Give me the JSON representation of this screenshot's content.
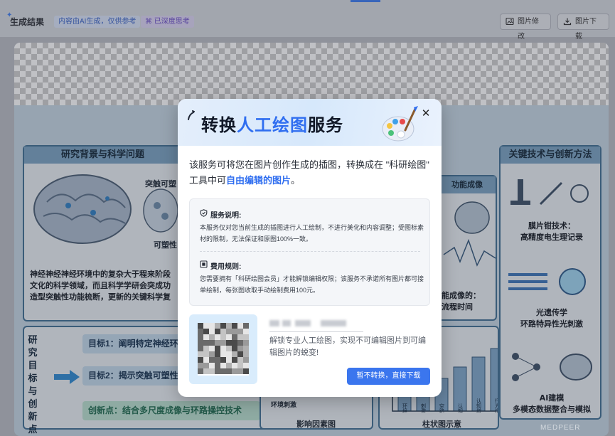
{
  "header": {
    "title": "生成结果",
    "badge_ai": "内容由AI生成，仅供参考",
    "badge_think": "已深度思考",
    "edit_button": "图片修改",
    "download_button": "图片下载"
  },
  "poster": {
    "left_panel_title": "研究背景与科学问题",
    "synapse_label": "突触可塑",
    "plasticity_label": "可塑性",
    "background_text": "神经神经神经环境中的复杂大于程来阶段文化的科学领域，而且科学学研会突成功造型突触性功能梳断，更新的关键科学复",
    "right_panel_title": "关键技术与创新方法",
    "tech1": "膜片钳技术：\n高精度电生理记录",
    "tech2": "光遗传学\n环路特异性光刺激",
    "tech3": "AI建模\n多模态数据整合与模拟",
    "mid_panel_title": "功能成像",
    "mid_caption": "能成像的：\n流程时间",
    "goals_vertical": "研究目标与创新点",
    "goal1": "目标1：阐明特定神经环路",
    "goal2": "目标2：揭示突触可塑性",
    "innovation": "创新点：结合多尺度成像与环路操控技术",
    "bottom_label_stim": "环境刺激",
    "bottom_caption_left": "影响因素图",
    "bottom_caption_right": "柱状图示意",
    "bar_labels": [
      "环境",
      "刺激",
      "空路",
      "认知",
      "认知增强",
      "行为增强"
    ]
  },
  "modal": {
    "title_part1": "转换",
    "title_part2": "人工绘图",
    "title_part3": "服务",
    "intro_text": "该服务可将您在图片创作生成的插图，转换成在 \"科研绘图\" 工具中可",
    "intro_highlight": "自由编辑的图片",
    "intro_end": "。",
    "service_title": "服务说明:",
    "service_body": "本服务仅对您当前生成的插图进行人工绘制，不进行美化和内容调整；受图标素材的限制，无法保证和原图100%一致。",
    "fee_title": "费用规则:",
    "fee_body": "您需要拥有「科研绘图会员」才能解锁编辑权限；该服务不承诺所有图片都可接单绘制，每张图收取手动绘制费用100元。",
    "promo_text": "解锁专业人工绘图，实现不可编辑图片到可编辑图片的蜕变!",
    "primary_button": "暂不转换，直接下载"
  },
  "watermark": "MEDPEER",
  "colors": {
    "accent_blue": "#3b76ee",
    "title_blue": "#2f6ef0",
    "badge_ai_bg": "#d8e2f7",
    "badge_think_bg": "#dcd5f3"
  }
}
